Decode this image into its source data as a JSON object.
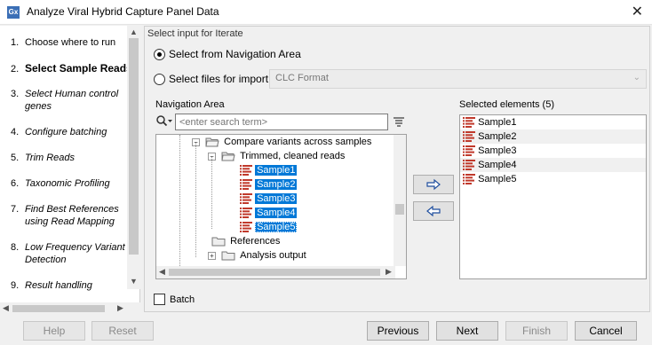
{
  "window": {
    "title": "Analyze Viral Hybrid Capture Panel Data",
    "app_icon": "Gx",
    "close_glyph": "✕"
  },
  "steps": [
    {
      "num": "1.",
      "label": "Choose where to run"
    },
    {
      "num": "2.",
      "label": "Select Sample Reads"
    },
    {
      "num": "3.",
      "label": "Select Human control genes"
    },
    {
      "num": "4.",
      "label": "Configure batching"
    },
    {
      "num": "5.",
      "label": "Trim Reads"
    },
    {
      "num": "6.",
      "label": "Taxonomic Profiling"
    },
    {
      "num": "7.",
      "label": "Find Best References using Read Mapping"
    },
    {
      "num": "8.",
      "label": "Low Frequency Variant Detection"
    },
    {
      "num": "9.",
      "label": "Result handling"
    }
  ],
  "input": {
    "section_title": "Select input for Iterate",
    "radio_navigation": "Select from Navigation Area",
    "radio_import": "Select files for import:",
    "import_format": "CLC Format",
    "nav_label": "Navigation Area",
    "search_placeholder": "<enter search term>",
    "tree": {
      "compare": "Compare variants across samples",
      "trimmed": "Trimmed, cleaned reads",
      "samples": [
        "Sample1",
        "Sample2",
        "Sample3",
        "Sample4",
        "Sample5"
      ],
      "references": "References",
      "analysis": "Analysis output"
    },
    "selected_label": "Selected elements (5)",
    "selected": [
      "Sample1",
      "Sample2",
      "Sample3",
      "Sample4",
      "Sample5"
    ],
    "batch_label": "Batch"
  },
  "buttons": {
    "help": "Help",
    "reset": "Reset",
    "previous": "Previous",
    "next": "Next",
    "finish": "Finish",
    "cancel": "Cancel"
  },
  "colors": {
    "selection": "#0078d7",
    "sequence_icon": "#c0392b",
    "folder": "#d9d9d9"
  }
}
